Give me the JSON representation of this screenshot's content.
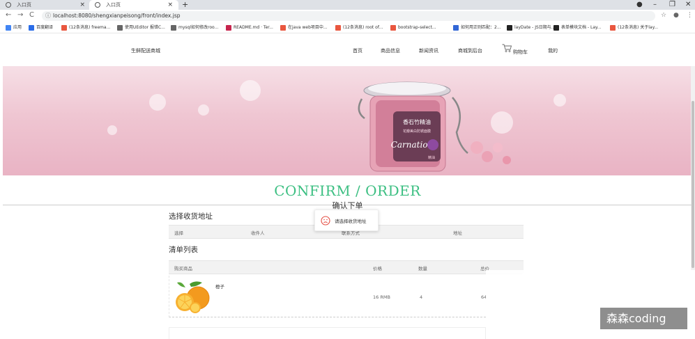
{
  "browser": {
    "tabs": [
      {
        "title": "入口页"
      },
      {
        "title": "入口页"
      }
    ],
    "new_tab": "+",
    "url": "localhost:8080/shengxianpeisong/front/index.jsp",
    "bookmarks": [
      {
        "label": "应用",
        "color": "#4285f4"
      },
      {
        "label": "百度翻译",
        "color": "#2b6de8"
      },
      {
        "label": "(12条消息) freema...",
        "color": "#e9573f"
      },
      {
        "label": "使用UEditor 报错C...",
        "color": "#666666"
      },
      {
        "label": "mysql如何修改roo...",
        "color": "#666666"
      },
      {
        "label": "README.md · Ter...",
        "color": "#c7254e"
      },
      {
        "label": "在java web项目中...",
        "color": "#e9573f"
      },
      {
        "label": "(12条消息) root of...",
        "color": "#e9573f"
      },
      {
        "label": "bootstrap-select...",
        "color": "#e9573f"
      },
      {
        "label": "如何用正则匹配：2...",
        "color": "#3367d6"
      },
      {
        "label": "layDate - JS日期与...",
        "color": "#222222"
      },
      {
        "label": "表单模块文档 - Lay...",
        "color": "#222222"
      },
      {
        "label": "(12条消息) 关于lay...",
        "color": "#e9573f"
      }
    ]
  },
  "site": {
    "brand": "生鲜配送商城",
    "nav": [
      "首页",
      "商品信息",
      "新闻资讯",
      "商城到后台",
      "购物车",
      "我的"
    ]
  },
  "banner": {
    "product_title": "香石竹精油",
    "product_subtitle": "花瓣美白防锈面膜",
    "brand_script": "Carnation",
    "product_tag": "精油"
  },
  "confirm": {
    "title": "CONFIRM / ORDER",
    "subtitle": "确认下单"
  },
  "address_section": {
    "title": "选择收货地址",
    "headers": [
      "选择",
      "收件人",
      "联系方式",
      "地址"
    ]
  },
  "list_section": {
    "title": "清单列表",
    "headers": [
      "购买商品",
      "价格",
      "数量",
      "总价"
    ],
    "rows": [
      {
        "name": "橙子",
        "price": "16 RMB",
        "qty": "4",
        "total": "64"
      }
    ]
  },
  "toast": {
    "message": "请选择收货地址",
    "icon": "sad-face-icon",
    "color": "#e54d42"
  },
  "watermark": "森森coding",
  "colors": {
    "accent": "#3cbf82"
  }
}
